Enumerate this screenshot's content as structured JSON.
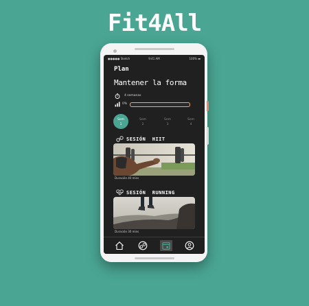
{
  "brand": "Fit4All",
  "status_bar": {
    "carrier": "Sketch",
    "time": "9:41 AM",
    "battery": "100%"
  },
  "screen": {
    "title": "Plan",
    "goal": "Mantener la forma",
    "duration_text": "4 semanas",
    "progress": {
      "label": "0%",
      "fraction": 0.0
    },
    "weeks": [
      {
        "label": "Sem",
        "number": "1",
        "active": true
      },
      {
        "label": "Sem",
        "number": "2",
        "active": false
      },
      {
        "label": "Sem",
        "number": "3",
        "active": false
      },
      {
        "label": "Sem",
        "number": "4",
        "active": false
      }
    ],
    "sessions": [
      {
        "prefix": "SESIÓN",
        "name": "HIIT",
        "icon": "barbell-icon",
        "duration": "Duración 40 mins"
      },
      {
        "prefix": "SESIÓN",
        "name": "RUNNING",
        "icon": "heartbeat-icon",
        "duration": "Duración 30 mins"
      }
    ]
  },
  "tabbar": {
    "items": [
      "home-icon",
      "dumbbell-circle-icon",
      "calendar-icon",
      "profile-icon"
    ],
    "active_index": 2
  },
  "colors": {
    "accent": "#4aa593",
    "progress": "#e8a77f",
    "screen_bg": "#202020"
  }
}
